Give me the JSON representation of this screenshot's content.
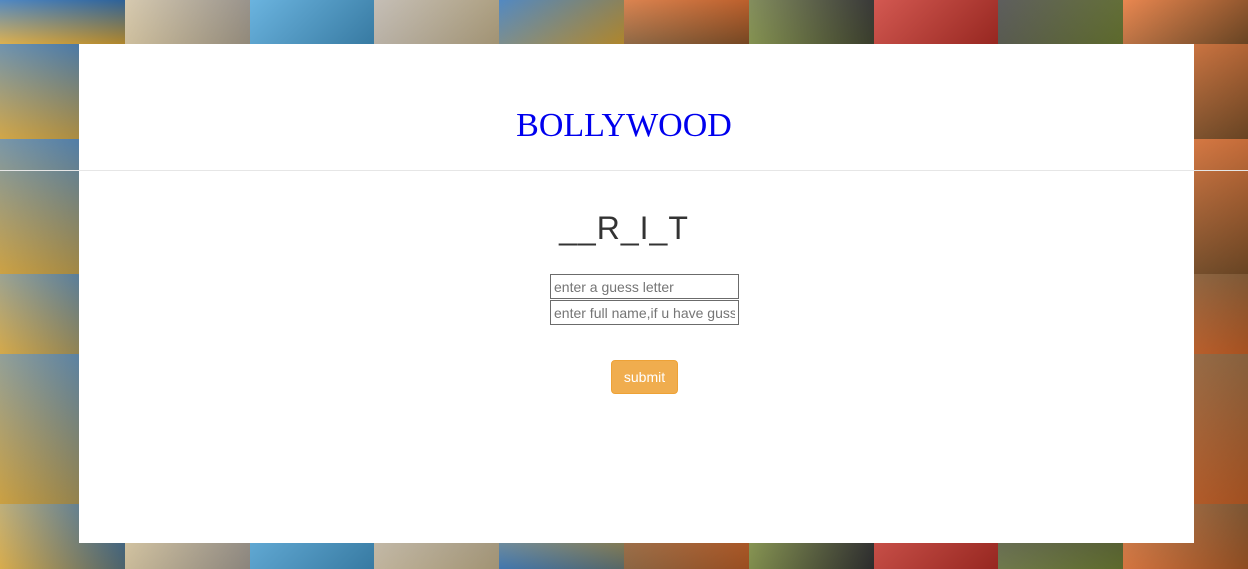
{
  "header": {
    "title": "BOLLYWOOD"
  },
  "game": {
    "masked_word": "__R_I_T"
  },
  "form": {
    "letter_placeholder": "enter a guess letter",
    "fullname_placeholder": "enter full name,if u have guss",
    "submit_label": "submit"
  },
  "background": {
    "description_colors": [
      "#e9b23a",
      "#c9342b",
      "#2c6fb5",
      "#d7c49a",
      "#3a3a3a",
      "#8a5a2e",
      "#4aa3d8",
      "#e56d2a",
      "#7b8c3a",
      "#b8b0a6"
    ]
  },
  "colors": {
    "title": "#0000ee",
    "submit_bg": "#f0ad4e",
    "panel_bg": "#ffffff"
  }
}
